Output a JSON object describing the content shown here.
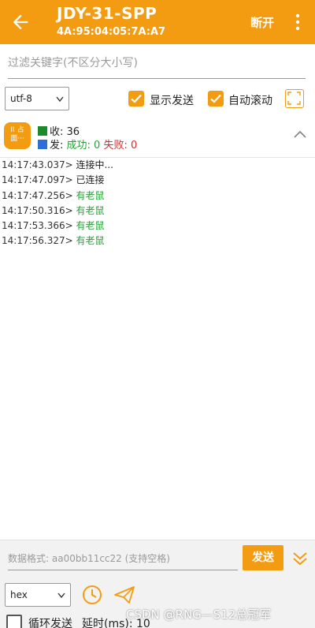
{
  "appbar": {
    "title": "JDY-31-SPP",
    "subtitle": "4A:95:04:05:7A:A7",
    "disconnect_label": "断开",
    "back_icon": "arrow-back-icon",
    "more_icon": "more-vert-icon",
    "color": "#f39c12"
  },
  "filter": {
    "placeholder": "过滤关键字(不区分大小写)"
  },
  "options": {
    "encoding": "utf-8",
    "show_send_label": "显示发送",
    "show_send_checked": true,
    "auto_scroll_label": "自动滚动",
    "auto_scroll_checked": true,
    "fullscreen_icon": "fullscreen-icon"
  },
  "stats": {
    "pause_icon": "pause-icon",
    "pause_text_top": "II 占",
    "pause_text_bottom": "面···",
    "recv_label": "收:",
    "recv_count": "36",
    "send_label": "发:",
    "success_label": "成功: 0",
    "fail_label": "失败: 0",
    "recv_color": "#1a8a2a",
    "send_color": "#2d6fd6"
  },
  "log": [
    {
      "time": "14:17:43.037>",
      "msg": "连接中...",
      "type": "status"
    },
    {
      "time": "14:17:47.097>",
      "msg": "已连接",
      "type": "status"
    },
    {
      "time": "14:17:47.256>",
      "msg": "有老鼠",
      "type": "data"
    },
    {
      "time": "14:17:50.316>",
      "msg": "有老鼠",
      "type": "data"
    },
    {
      "time": "14:17:53.366>",
      "msg": "有老鼠",
      "type": "data"
    },
    {
      "time": "14:17:56.327>",
      "msg": "有老鼠",
      "type": "data"
    }
  ],
  "send": {
    "placeholder": "数据格式: aa00bb11cc22 (支持空格)",
    "button_label": "发送",
    "format": "hex",
    "loop_label": "循环发送",
    "loop_checked": false,
    "delay_label": "延时(ms): 10"
  },
  "watermark": "CSDN @RNG—S12总冠军"
}
